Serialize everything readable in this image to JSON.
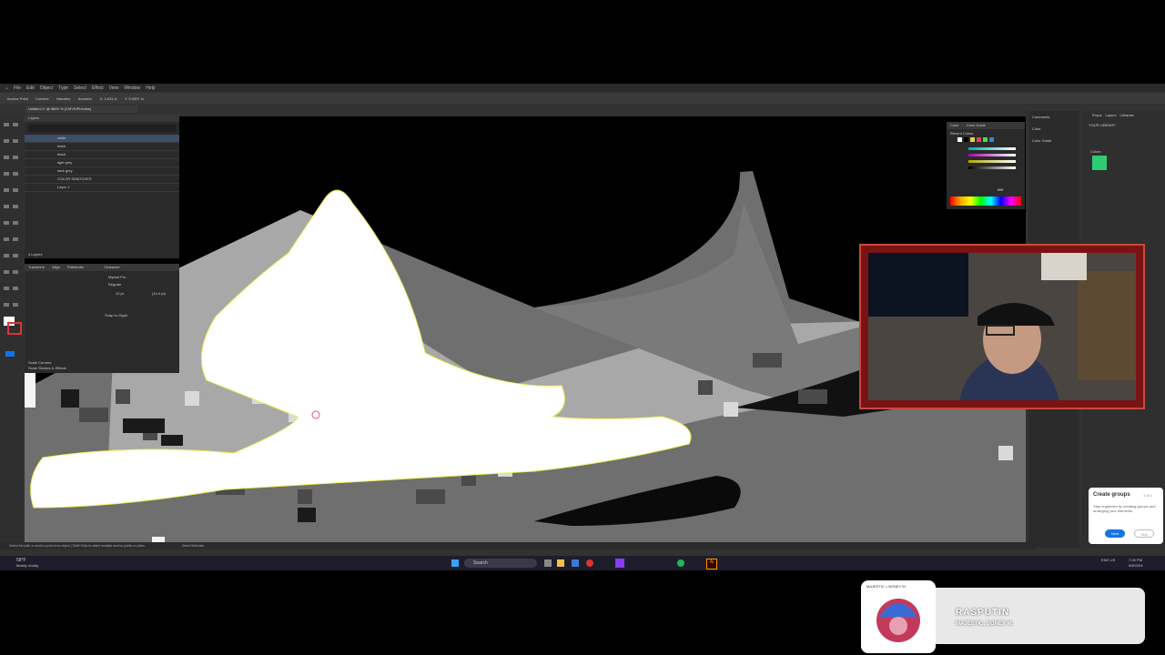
{
  "app": {
    "menu": [
      "File",
      "Edit",
      "Object",
      "Type",
      "Select",
      "Effect",
      "View",
      "Window",
      "Help"
    ],
    "control_bar": [
      "Anchor Point",
      "Convert:",
      "Handles:",
      "Anchors:",
      "X: 4.631 in",
      "Y: 5.0957 in"
    ],
    "doc_tab": "Untitled-1* @ 9800 % (CMYK/Preview)",
    "layers_panel_title": "Layers",
    "layers": [
      "white",
      "black",
      "black",
      "light grey",
      "dark grey",
      "COLOR SWATCHES",
      "Layer 1"
    ],
    "layers_count": "4 Layers",
    "props_tabs": [
      "Transform",
      "Align",
      "Pathfinder"
    ],
    "character_tab": "Character",
    "font_name": "Myriad Pro",
    "font_style": "Regular",
    "font_size": "12 pt",
    "leading": "(14.4 pt)",
    "snap_label": "Snap to Glyph",
    "scale_corners": "Scale Corners",
    "scale_strokes": "Scale Strokes & Effects",
    "status_text": "Select the path or anchor point of an object  |  Shift+Click to select multiple anchor points or paths",
    "status_tool": "Direct Selection"
  },
  "color_panel": {
    "tabs": [
      "Color",
      "Color Guide"
    ],
    "recent_label": "Recent Colors",
    "hex": "ffffff"
  },
  "side_panel": {
    "comments": "Comments",
    "color": "Color",
    "color_guide": "Color Guide"
  },
  "libraries": {
    "tabs": [
      "Props",
      "Layers",
      "Libraries"
    ],
    "title": "YOUR LIBRARY",
    "colors_label": "Colors",
    "swatch": "#2ecc71"
  },
  "tooltip": {
    "title": "Create groups",
    "step": "1 of 1",
    "body": "Stay organized by creating groups and arranging your elements.",
    "next": "Next",
    "skip": "Skip"
  },
  "taskbar": {
    "weather_temp": "58°F",
    "weather_text": "Mostly cloudy",
    "search": "Search",
    "lang": "ENG US",
    "time": "7:05 PM",
    "date": "5/8/2024"
  },
  "music": {
    "title": "RASPUTIN",
    "artist": "MAJESTIC, BONEY M.",
    "album_label": "MAJESTIC × BONEY M."
  }
}
